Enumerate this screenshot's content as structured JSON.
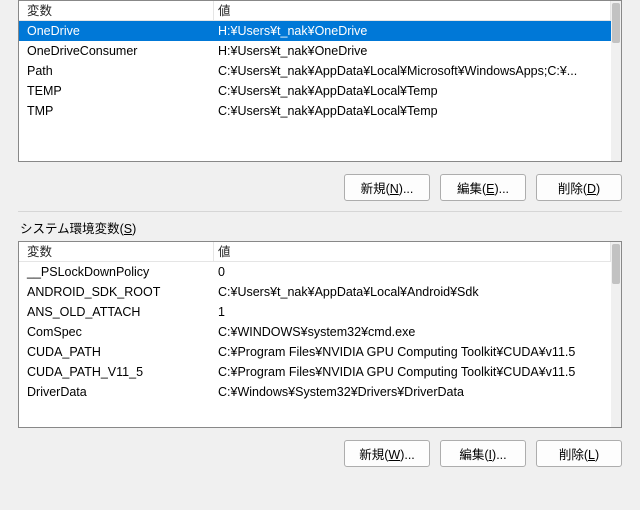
{
  "headers": {
    "name": "変数",
    "value": "値"
  },
  "user_vars": [
    {
      "name": "OneDrive",
      "value": "H:¥Users¥t_nak¥OneDrive",
      "selected": true
    },
    {
      "name": "OneDriveConsumer",
      "value": "H:¥Users¥t_nak¥OneDrive"
    },
    {
      "name": "Path",
      "value": "C:¥Users¥t_nak¥AppData¥Local¥Microsoft¥WindowsApps;C:¥..."
    },
    {
      "name": "TEMP",
      "value": "C:¥Users¥t_nak¥AppData¥Local¥Temp"
    },
    {
      "name": "TMP",
      "value": "C:¥Users¥t_nak¥AppData¥Local¥Temp"
    }
  ],
  "user_buttons": {
    "new": {
      "pre": "新規(",
      "key": "N",
      "post": ")..."
    },
    "edit": {
      "pre": "編集(",
      "key": "E",
      "post": ")..."
    },
    "delete": {
      "pre": "削除(",
      "key": "D",
      "post": ")"
    }
  },
  "system_label": {
    "pre": "システム環境変数(",
    "key": "S",
    "post": ")"
  },
  "system_vars": [
    {
      "name": "__PSLockDownPolicy",
      "value": "0"
    },
    {
      "name": "ANDROID_SDK_ROOT",
      "value": "C:¥Users¥t_nak¥AppData¥Local¥Android¥Sdk"
    },
    {
      "name": "ANS_OLD_ATTACH",
      "value": "1"
    },
    {
      "name": "ComSpec",
      "value": "C:¥WINDOWS¥system32¥cmd.exe"
    },
    {
      "name": "CUDA_PATH",
      "value": "C:¥Program Files¥NVIDIA GPU Computing Toolkit¥CUDA¥v11.5"
    },
    {
      "name": "CUDA_PATH_V11_5",
      "value": "C:¥Program Files¥NVIDIA GPU Computing Toolkit¥CUDA¥v11.5"
    },
    {
      "name": "DriverData",
      "value": "C:¥Windows¥System32¥Drivers¥DriverData"
    }
  ],
  "system_buttons": {
    "new": {
      "pre": "新規(",
      "key": "W",
      "post": ")..."
    },
    "edit": {
      "pre": "編集(",
      "key": "I",
      "post": ")..."
    },
    "delete": {
      "pre": "削除(",
      "key": "L",
      "post": ")"
    }
  }
}
